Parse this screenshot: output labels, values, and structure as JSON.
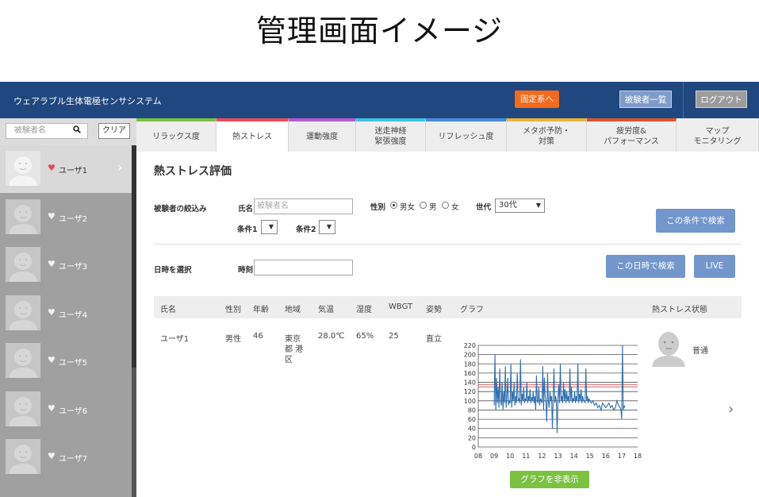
{
  "slide_title": "管理画面イメージ",
  "header": {
    "app_name": "ウェアラブル生体電極センサシステム",
    "fixed_button": "固定系へ",
    "subject_list_button": "被験者一覧",
    "logout_button": "ログアウト",
    "colors": {
      "bar": "#21477f",
      "fixed": "#f26a1b"
    }
  },
  "sidebar": {
    "search_placeholder": "被験者名",
    "clear_button": "クリア",
    "users": [
      {
        "name": "ユーザ1",
        "favorite": true,
        "selected": true
      },
      {
        "name": "ユーザ2",
        "favorite": false
      },
      {
        "name": "ユーザ3",
        "favorite": false
      },
      {
        "name": "ユーザ4",
        "favorite": false
      },
      {
        "name": "ユーザ5",
        "favorite": false
      },
      {
        "name": "ユーザ6",
        "favorite": false
      },
      {
        "name": "ユーザ7",
        "favorite": false
      }
    ]
  },
  "tabs": [
    {
      "label": "リラックス度",
      "color": "#7cc142"
    },
    {
      "label": "熱ストレス",
      "color": "#e84c5c",
      "active": true
    },
    {
      "label": "運動強度",
      "color": "#b35ad1"
    },
    {
      "label": "迷走神経\n緊張強度",
      "color": "#3ec1e0"
    },
    {
      "label": "リフレッシュ度",
      "color": "#4a8ad8"
    },
    {
      "label": "メタボ予防・\n対策",
      "color": "#e6b53a"
    },
    {
      "label": "疲労度&\nパフォーマンス",
      "color": "#d7572a"
    },
    {
      "label": "マップ\nモニタリング",
      "color": "#eeeeee"
    }
  ],
  "main": {
    "title": "熱ストレス評価",
    "filter": {
      "label": "被験者の絞込み",
      "name_label": "氏名",
      "name_placeholder": "被験者名",
      "gender_label": "性別",
      "gender_options": [
        "男女",
        "男",
        "女"
      ],
      "gender_selected": "男女",
      "generation_label": "世代",
      "generation_value": "30代",
      "cond1_label": "条件1",
      "cond2_label": "条件2",
      "search_button": "この条件で検索"
    },
    "date": {
      "label": "日時を選択",
      "time_label": "時刻",
      "search_button": "この日時で検索",
      "live_button": "LIVE"
    },
    "table": {
      "headers": [
        "氏名",
        "性別",
        "年齢",
        "地域",
        "気温",
        "湿度",
        "WBGT",
        "姿勢",
        "グラフ",
        "熱ストレス状態"
      ],
      "row": {
        "name": "ユーザ1",
        "gender": "男性",
        "age": "46",
        "region_1": "東京",
        "region_2": "都 港",
        "region_3": "区",
        "temp": "28.0℃",
        "humidity": "65%",
        "wbgt": "25",
        "posture": "直立",
        "status": "普通"
      },
      "graph_toggle_button": "グラフを非表示"
    }
  },
  "chart_data": {
    "type": "line",
    "title": "",
    "xlabel": "",
    "ylabel": "",
    "x_ticks": [
      "08",
      "09",
      "10",
      "11",
      "12",
      "13",
      "14",
      "15",
      "16",
      "17",
      "18"
    ],
    "y_ticks": [
      0,
      20,
      40,
      60,
      80,
      100,
      120,
      140,
      160,
      180,
      200,
      220
    ],
    "xlim": [
      8,
      18
    ],
    "ylim": [
      0,
      220
    ],
    "grid": true,
    "threshold_lines": [
      130,
      135
    ],
    "threshold_color": "#e06060",
    "series_color": "#2f6fb0",
    "series": [
      {
        "x": [
          9.0,
          9.05,
          9.1,
          9.15,
          9.2,
          9.25,
          9.3,
          9.35,
          9.4,
          9.45,
          9.5,
          9.55,
          9.6,
          9.65,
          9.7,
          9.75,
          9.8,
          9.85,
          9.9,
          9.95,
          10.0,
          10.05,
          10.1,
          10.15,
          10.2,
          10.25,
          10.3,
          10.35,
          10.4,
          10.45,
          10.5,
          10.55,
          10.6,
          10.65,
          10.7,
          10.75,
          10.8,
          10.85,
          10.9,
          10.95,
          11.0,
          11.05,
          11.1,
          11.15,
          11.2,
          11.25,
          11.3,
          11.35,
          11.4,
          11.45,
          11.5,
          11.55,
          11.6,
          11.65,
          11.7,
          11.75,
          11.8,
          11.85,
          11.9,
          11.95,
          12.0,
          12.05,
          12.1,
          12.15,
          12.2,
          12.25,
          12.3,
          12.35,
          12.4,
          12.45,
          12.5,
          12.55,
          12.6,
          12.65,
          12.7,
          12.75,
          12.8,
          12.85,
          12.9,
          12.95,
          13.0,
          13.05,
          13.1,
          13.15,
          13.2,
          13.25,
          13.3,
          13.35,
          13.4,
          13.45,
          13.5,
          13.55,
          13.6,
          13.65,
          13.7,
          13.75,
          13.8,
          13.85,
          13.9,
          13.95,
          14.0,
          14.05,
          14.1,
          14.15,
          14.2,
          14.25,
          14.3,
          14.35,
          14.4,
          14.45,
          14.5,
          14.55,
          14.6,
          14.65,
          14.7,
          14.75,
          14.8,
          14.85,
          14.9,
          14.95,
          15.0,
          15.1,
          15.2,
          15.3,
          15.4,
          15.5,
          15.6,
          15.7,
          15.8,
          15.9,
          16.0,
          16.1,
          16.2,
          16.3,
          16.4,
          16.5,
          16.6,
          16.7,
          16.8,
          16.9,
          16.95,
          17.0,
          17.05,
          17.1,
          17.15,
          17.2
        ],
        "y": [
          90,
          200,
          80,
          150,
          95,
          130,
          85,
          170,
          100,
          90,
          140,
          80,
          120,
          95,
          175,
          85,
          110,
          150,
          90,
          100,
          95,
          180,
          85,
          120,
          100,
          140,
          90,
          110,
          95,
          160,
          100,
          105,
          95,
          190,
          90,
          115,
          100,
          130,
          95,
          105,
          100,
          140,
          95,
          110,
          100,
          125,
          95,
          108,
          100,
          120,
          95,
          110,
          80,
          155,
          100,
          95,
          130,
          90,
          105,
          100,
          95,
          175,
          80,
          150,
          110,
          95,
          55,
          160,
          100,
          85,
          120,
          100,
          110,
          40,
          105,
          170,
          95,
          110,
          100,
          30,
          105,
          135,
          95,
          180,
          100,
          110,
          95,
          140,
          100,
          125,
          95,
          120,
          100,
          110,
          95,
          170,
          100,
          130,
          95,
          105,
          100,
          120,
          95,
          110,
          100,
          180,
          95,
          115,
          100,
          125,
          95,
          110,
          100,
          100,
          95,
          170,
          100,
          110,
          95,
          105,
          100,
          95,
          100,
          90,
          95,
          85,
          90,
          80,
          95,
          90,
          85,
          90,
          95,
          85,
          90,
          80,
          85,
          100,
          90,
          85,
          80,
          60,
          220,
          80,
          90,
          85
        ]
      }
    ]
  }
}
